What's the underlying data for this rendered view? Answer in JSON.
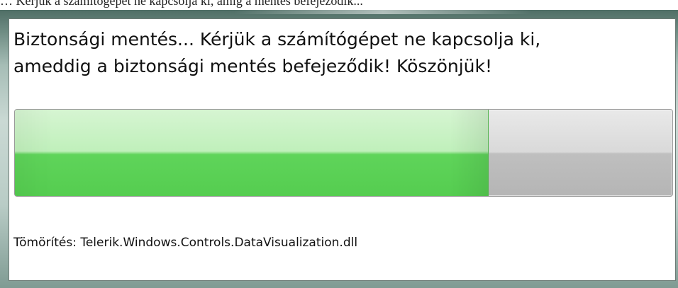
{
  "window": {
    "partial_title": "… Kérjük a számítógépet ne kapcsolja ki, amig a mentés befejeződik..."
  },
  "dialog": {
    "message": "Biztonsági mentés... Kérjük a számítógépet ne kapcsolja ki,\nameddig a biztonsági mentés befejeződik! Köszönjük!",
    "status": "Tömörítés: Telerik.Windows.Controls.DataVisualization.dll"
  },
  "progress": {
    "fraction": 0.72
  },
  "colors": {
    "progress_fill": "#55cd50",
    "progress_track": "#bfbfbf",
    "frame": "#a6bdb6"
  }
}
